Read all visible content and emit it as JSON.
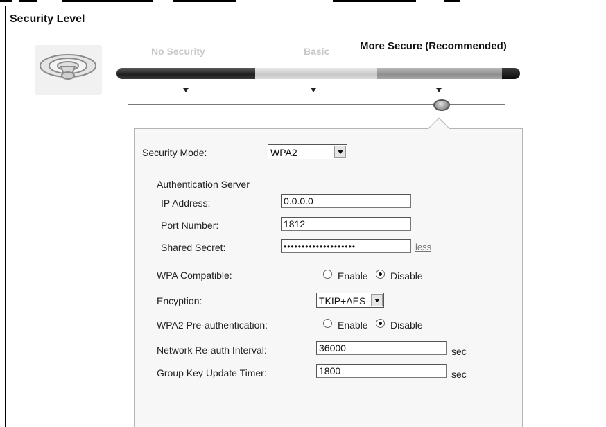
{
  "title": "Security Level",
  "levels": {
    "no_security": "No Security",
    "basic": "Basic",
    "more_secure": "More Secure (Recommended)",
    "selected": "More Secure (Recommended)"
  },
  "form": {
    "security_mode": {
      "label": "Security Mode:",
      "value": "WPA2"
    },
    "auth_server": {
      "heading": "Authentication Server",
      "ip_label": "IP Address:",
      "ip_value": "0.0.0.0",
      "port_label": "Port Number:",
      "port_value": "1812",
      "secret_label": "Shared Secret:",
      "secret_value": "••••••••••••••••••••",
      "less_link": "less"
    },
    "wpa_compatible": {
      "label": "WPA Compatible:",
      "enable": "Enable",
      "disable": "Disable",
      "selected": "Disable"
    },
    "encryption": {
      "label": "Encyption:",
      "value": "TKIP+AES"
    },
    "wpa2_preauth": {
      "label": "WPA2 Pre-authentication:",
      "enable": "Enable",
      "disable": "Disable",
      "selected": "Disable"
    },
    "reauth_interval": {
      "label": "Network Re-auth Interval:",
      "value": "36000",
      "unit": "sec"
    },
    "group_key_timer": {
      "label": "Group Key Update Timer:",
      "value": "1800",
      "unit": "sec"
    }
  },
  "icons": {
    "wireless": "wireless-signal-icon",
    "dropdown": "chevron-down-icon"
  },
  "colors": {
    "panel_bg": "#f7f7f7",
    "track_dark": "#1e1e1e"
  }
}
